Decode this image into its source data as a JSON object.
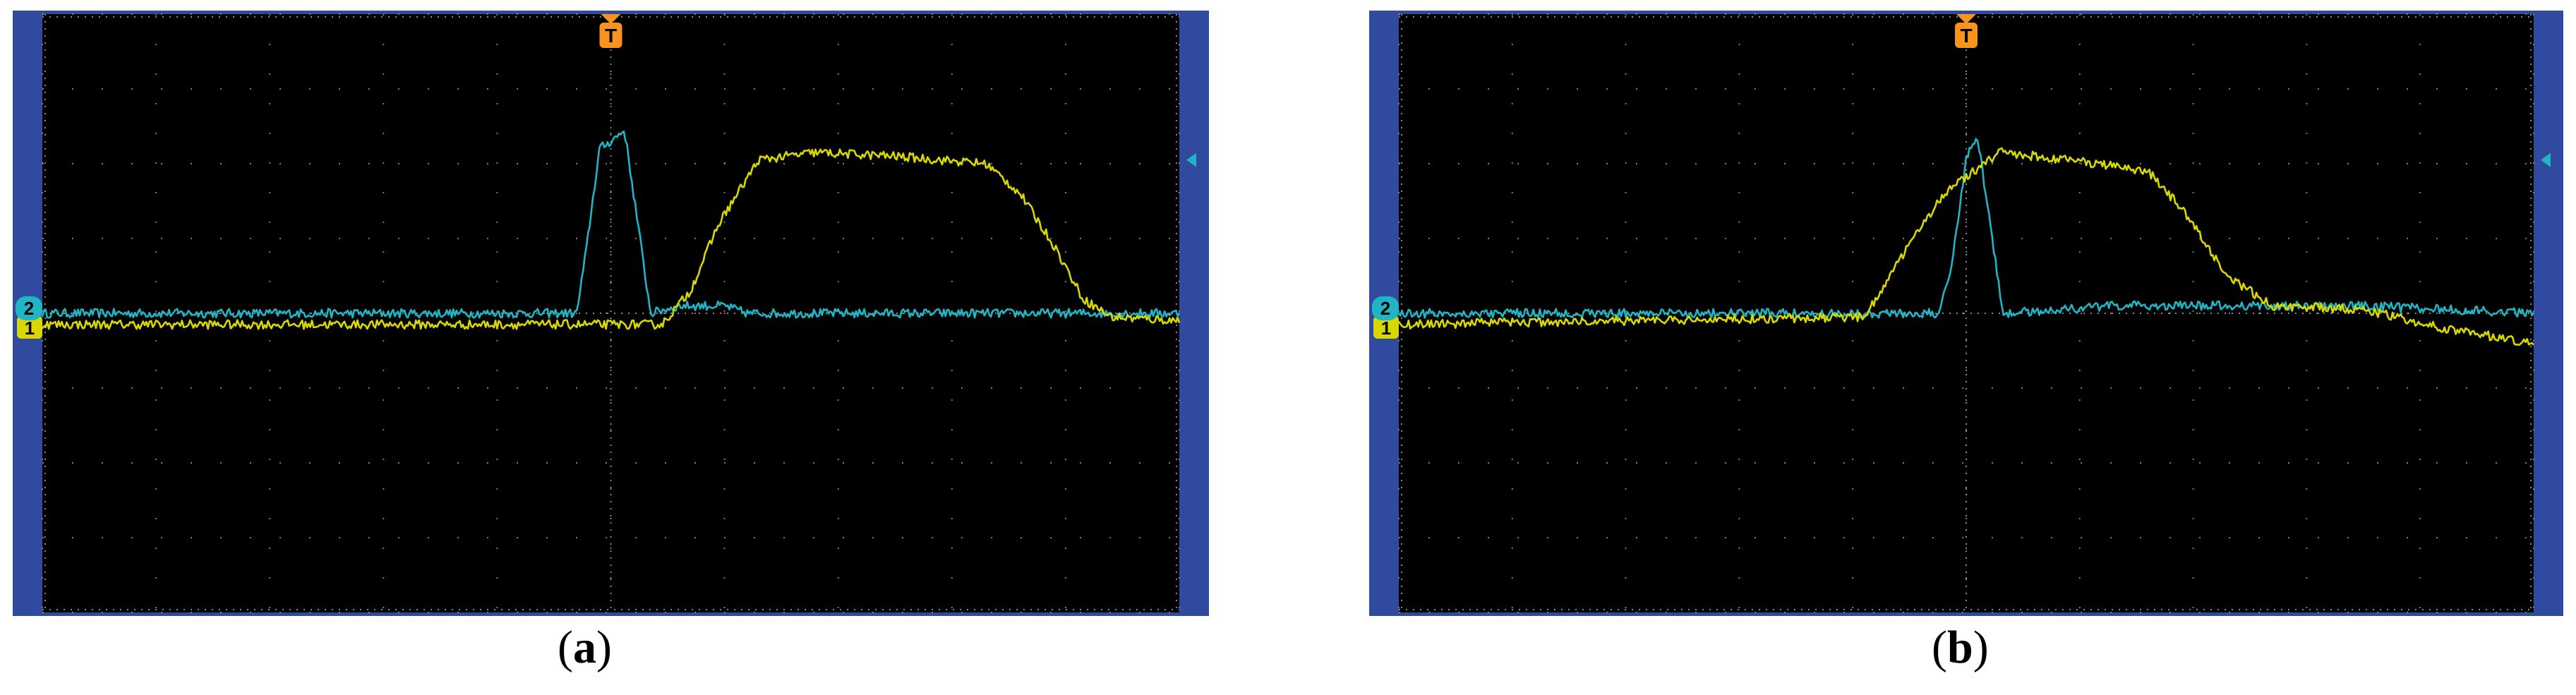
{
  "captions": {
    "a": {
      "open": "(",
      "letter": "a",
      "close": ")"
    },
    "b": {
      "open": "(",
      "letter": "b",
      "close": ")"
    }
  },
  "markers": {
    "trigger": "T",
    "channel2": "2",
    "channel1": "1"
  },
  "colors": {
    "screen_bg": "#000000",
    "bezel": "#2f4a9e",
    "grid": "#8a8a8a",
    "trigger_marker": "#f7941d",
    "channel1": "#d8d800",
    "channel2": "#1fb5c4"
  },
  "chart_data": [
    {
      "type": "line",
      "panel": "a",
      "xlim": [
        -5,
        5
      ],
      "ylim": [
        -4,
        4
      ],
      "grid": true,
      "series": [
        {
          "color": "#1fb5c4",
          "points": [
            [
              -5,
              0
            ],
            [
              -0.3,
              0
            ],
            [
              -0.22,
              0.8
            ],
            [
              -0.1,
              2.2
            ],
            [
              0,
              2.3
            ],
            [
              0.12,
              2.45
            ],
            [
              0.2,
              1.6
            ],
            [
              0.35,
              0
            ],
            [
              0.6,
              0.1
            ],
            [
              1.0,
              0.1
            ],
            [
              1.2,
              0
            ],
            [
              5,
              0
            ]
          ]
        },
        {
          "color": "#d8d800",
          "points": [
            [
              -5,
              -0.15
            ],
            [
              0.45,
              -0.15
            ],
            [
              0.7,
              0.3
            ],
            [
              0.95,
              1.2
            ],
            [
              1.3,
              2.05
            ],
            [
              1.8,
              2.15
            ],
            [
              2.5,
              2.1
            ],
            [
              3.3,
              2.0
            ],
            [
              3.6,
              1.6
            ],
            [
              3.9,
              0.9
            ],
            [
              4.15,
              0.2
            ],
            [
              4.4,
              -0.05
            ],
            [
              5,
              -0.1
            ]
          ]
        }
      ]
    },
    {
      "type": "line",
      "panel": "b",
      "xlim": [
        -5,
        5
      ],
      "ylim": [
        -4,
        4
      ],
      "grid": true,
      "series": [
        {
          "color": "#1fb5c4",
          "points": [
            [
              -5,
              0
            ],
            [
              -0.25,
              0
            ],
            [
              -0.12,
              0.7
            ],
            [
              0,
              2.1
            ],
            [
              0.1,
              2.35
            ],
            [
              0.22,
              1.1
            ],
            [
              0.32,
              0
            ],
            [
              1.3,
              0.1
            ],
            [
              2.2,
              0.1
            ],
            [
              3.5,
              0.1
            ],
            [
              5,
              0
            ]
          ]
        },
        {
          "color": "#d8d800",
          "points": [
            [
              -5,
              -0.15
            ],
            [
              -0.9,
              -0.05
            ],
            [
              -0.55,
              0.8
            ],
            [
              -0.2,
              1.6
            ],
            [
              0.3,
              2.15
            ],
            [
              0.9,
              2.05
            ],
            [
              1.6,
              1.9
            ],
            [
              1.9,
              1.4
            ],
            [
              2.3,
              0.5
            ],
            [
              2.7,
              0.1
            ],
            [
              3.5,
              0.05
            ],
            [
              4.2,
              -0.2
            ],
            [
              5,
              -0.4
            ]
          ]
        }
      ]
    }
  ]
}
